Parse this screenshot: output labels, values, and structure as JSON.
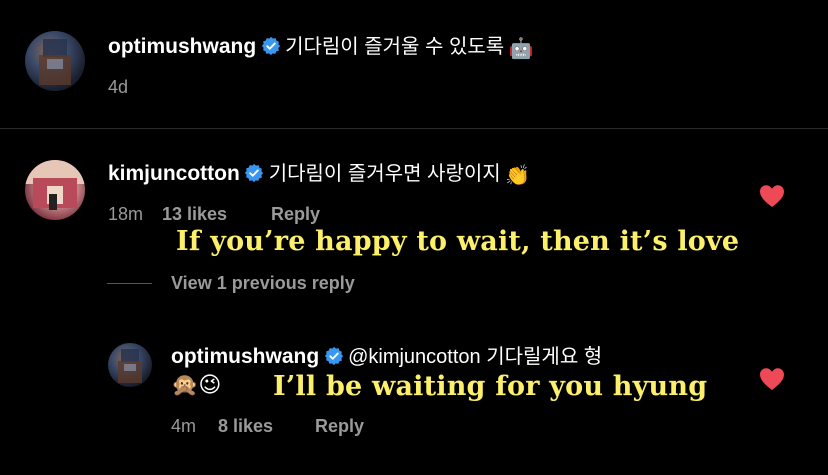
{
  "post_comment": {
    "username": "optimushwang",
    "text": "기다림이 즐거울 수 있도록",
    "emoji": "🤖",
    "time": "4d"
  },
  "comment_1": {
    "username": "kimjuncotton",
    "text": "기다림이 즐거우면 사랑이지",
    "emoji": "👏",
    "time": "18m",
    "likes": "13 likes",
    "reply_label": "Reply",
    "translation": "If you’re happy to wait, then it’s love",
    "view_replies": "View 1 previous reply"
  },
  "reply_1": {
    "username": "optimushwang",
    "text": "@kimjuncotton 기다릴게요 형",
    "emojis": "🙊😉",
    "time": "4m",
    "likes": "8 likes",
    "reply_label": "Reply",
    "translation": "I’ll be waiting for you hyung"
  },
  "colors": {
    "background": "#000000",
    "verified": "#3897f0",
    "heart": "#ed4956",
    "overlay_text": "#fcef6a",
    "meta_text": "#9a9a9a"
  },
  "icons": [
    "verified-badge-icon",
    "heart-icon"
  ]
}
